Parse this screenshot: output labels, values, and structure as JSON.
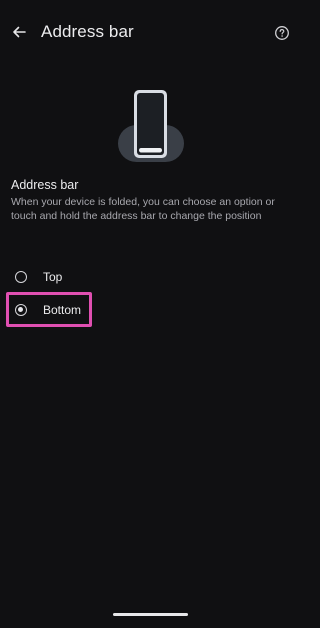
{
  "appbar": {
    "title": "Address bar",
    "back_icon": "arrow-back-icon",
    "help_icon": "help-circle-icon"
  },
  "illustration": {
    "icon": "phone-bottom-bar-illustration",
    "colors": {
      "phone": "#d9dde4",
      "screen": "#1c1f24",
      "stand": "#3a3f47",
      "bar": "#f0f2f5"
    }
  },
  "section": {
    "title": "Address bar",
    "description": "When your device is folded, you can choose an option or touch and hold the address bar to change the position"
  },
  "options": [
    {
      "label": "Top",
      "checked": false
    },
    {
      "label": "Bottom",
      "checked": true
    }
  ],
  "colors": {
    "background": "#101012",
    "highlight": "#e04fb1",
    "text": "#ececee",
    "secondary_text": "#a8a8ae"
  }
}
